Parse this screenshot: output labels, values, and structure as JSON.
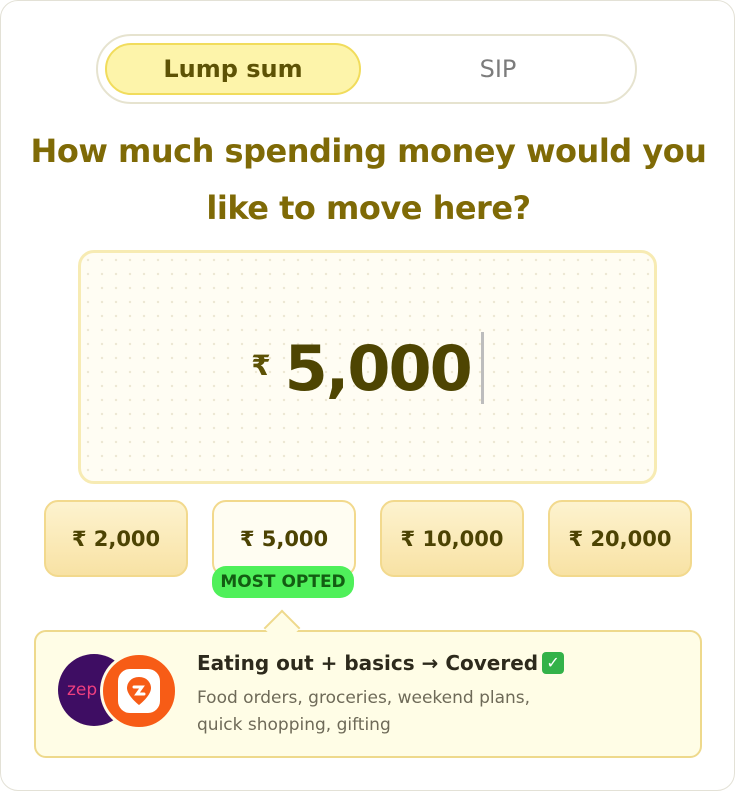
{
  "mode_toggle": {
    "options": [
      "Lump sum",
      "SIP"
    ],
    "selected": "Lump sum"
  },
  "question": "How much spending money would you like to move here?",
  "amount": {
    "currency_symbol": "₹",
    "value": "5,000"
  },
  "quick_amounts": [
    "₹ 2,000",
    "₹ 5,000",
    "₹ 10,000",
    "₹ 20,000"
  ],
  "selected_quick_amount": "₹ 5,000",
  "badge": "MOST OPTED",
  "info": {
    "title": "Eating out + basics → Covered",
    "title_emoji": "✅",
    "description": "Food orders, groceries, weekend plans, quick shopping, gifting",
    "logos": [
      "zepto",
      "swiggy"
    ],
    "zepto_text": "zep"
  },
  "colors": {
    "accent": "#7f6a06",
    "badge": "#4ff05a",
    "swiggy": "#f75c16",
    "zepto": "#3e0d63"
  }
}
